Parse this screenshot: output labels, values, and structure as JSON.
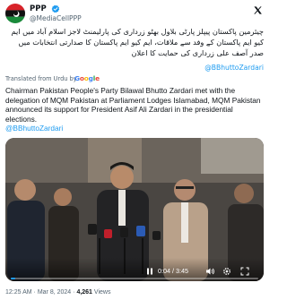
{
  "header": {
    "display_name": "PPP",
    "handle": "@MediaCellPPP",
    "verified_icon": "verified-badge-icon",
    "platform_icon": "x-logo-icon"
  },
  "tweet": {
    "urdu_text": "چیئرمین پاکستان پیپلز پارٹی بلاول بھٹو زرداری کی پارلیمنٹ لاجز اسلام آباد میں ایم کیو ایم پاکستان کے وفد سے ملاقات، ایم کیو ایم پاکستان کا صدارتی انتخابات میں صدر آصف علی زرداری کی حمایت کا اعلان",
    "urdu_mention": "@BBhuttoZardari",
    "translated_label": "Translated from Urdu by",
    "translator": "Google",
    "english_text": "Chairman Pakistan People's Party Bilawal Bhutto Zardari met with the delegation of MQM Pakistan at Parliament Lodges Islamabad, MQM Pakistan announced its support for President Asif Ali Zardari in the presidential elections.",
    "english_mention": "@BBhuttoZardari"
  },
  "video": {
    "time_display": "0:04 / 3:45",
    "progress_fraction": 0.018,
    "accent": "#1d9bf0"
  },
  "footer": {
    "time": "12:25 AM",
    "separator": "·",
    "date": "Mar 8, 2024",
    "views_count": "4,261",
    "views_label": "Views"
  }
}
